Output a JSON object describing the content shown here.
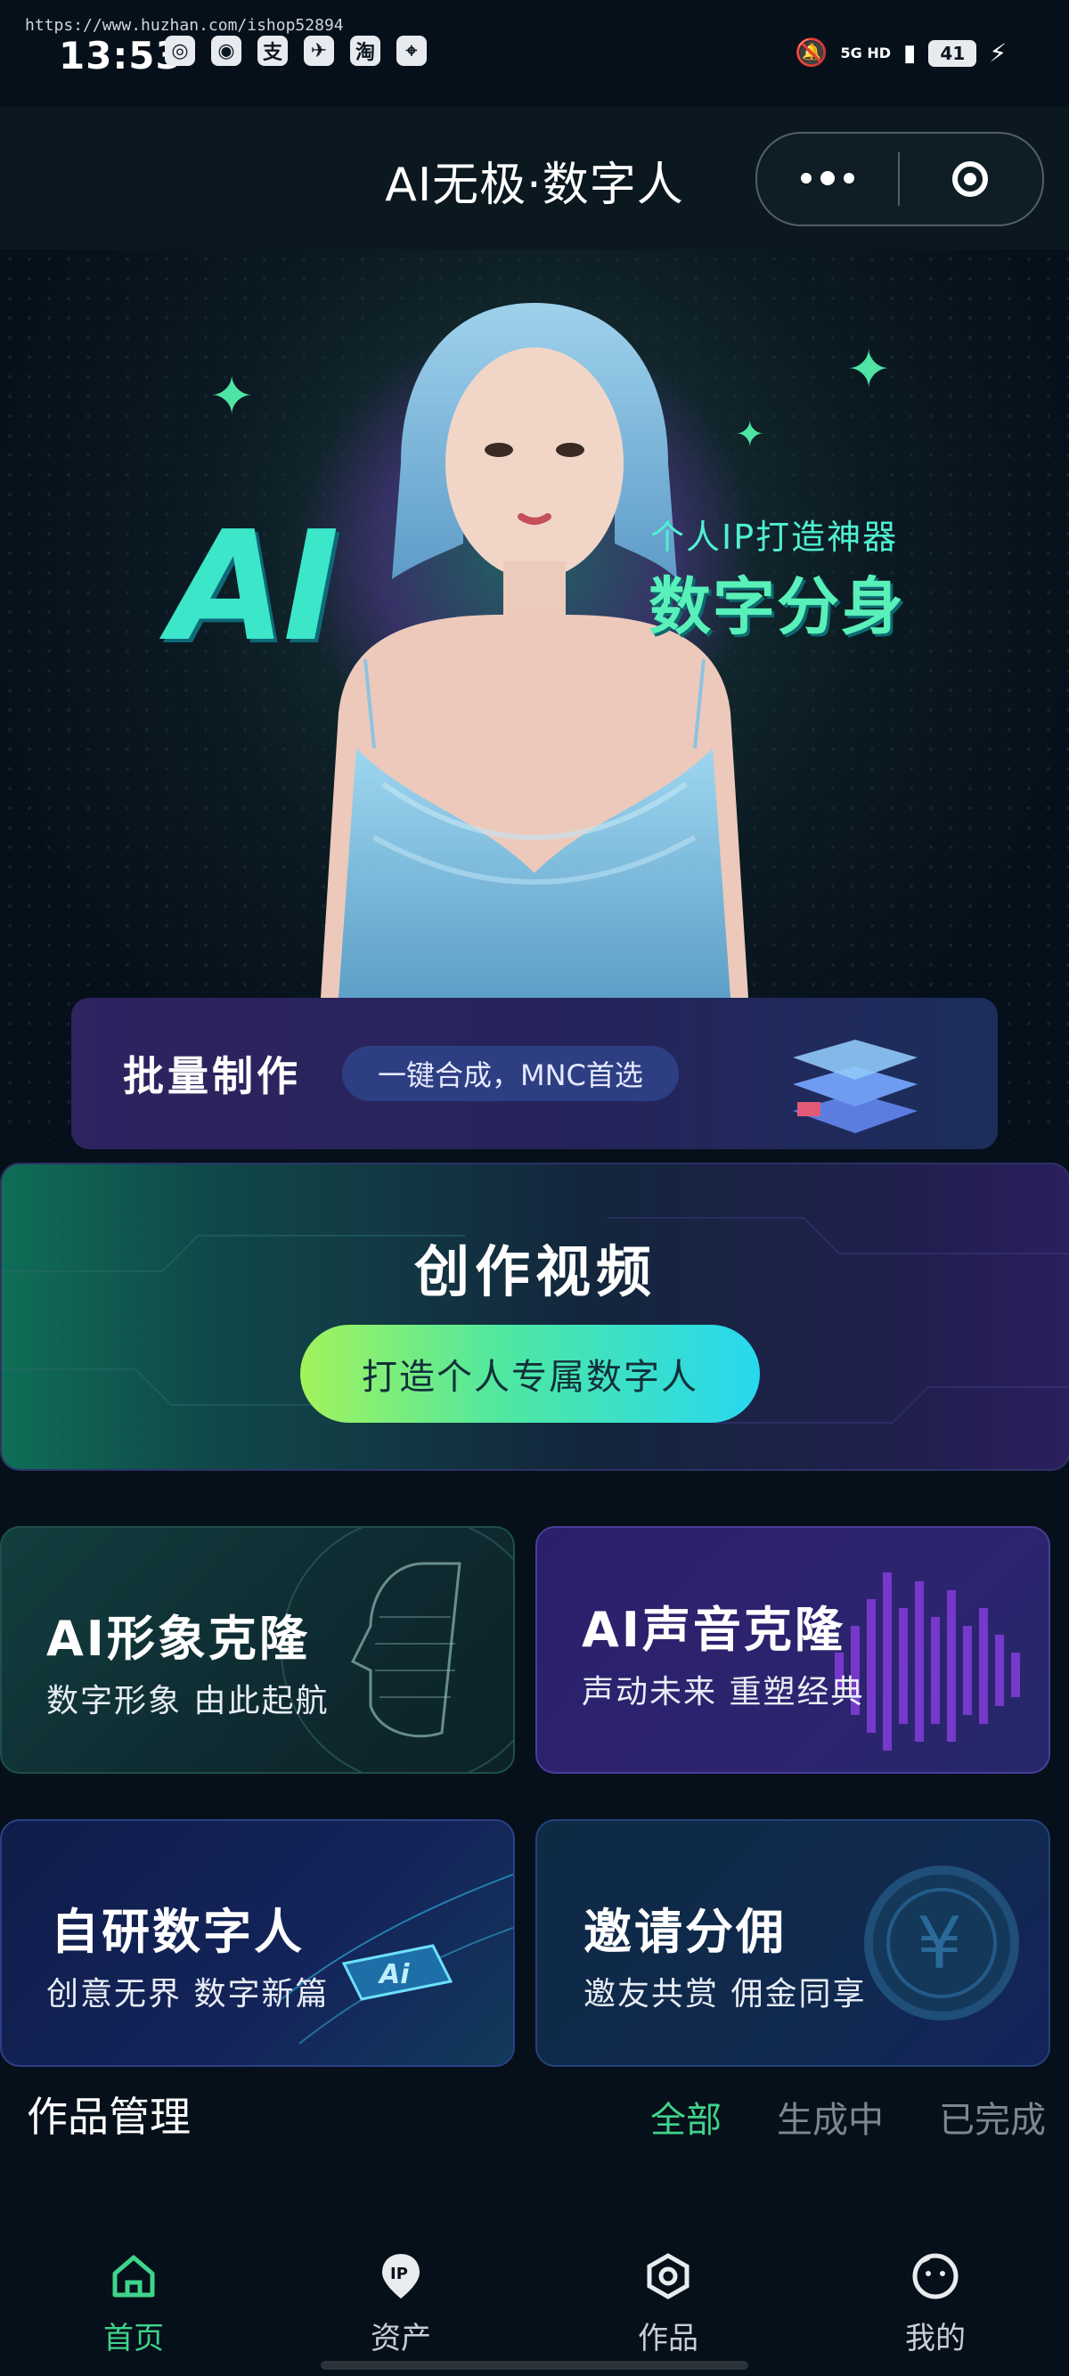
{
  "status_bar": {
    "watermark": "https://www.huzhan.com/ishop52894",
    "time": "13:53",
    "network": "5G HD",
    "battery": "41",
    "icons": [
      "circle-app-icon",
      "weibo-icon",
      "alipay-icon",
      "bird-icon",
      "taobao-icon",
      "location-icon"
    ]
  },
  "titlebar": {
    "title": "AI无极·数字人"
  },
  "banner": {
    "big_text": "AI",
    "subtitle": "个人IP打造神器",
    "headline": "数字分身"
  },
  "batch": {
    "title": "批量制作",
    "pill": "一键合成，MNC首选"
  },
  "create": {
    "title": "创作视频",
    "button": "打造个人专属数字人"
  },
  "cards": [
    {
      "title": "AI形象克隆",
      "sub": "数字形象 由此起航"
    },
    {
      "title": "AI声音克隆",
      "sub": "声动未来 重塑经典"
    },
    {
      "title": "自研数字人",
      "sub": "创意无界 数字新篇"
    },
    {
      "title": "邀请分佣",
      "sub": "邀友共赏 佣金同享"
    }
  ],
  "works": {
    "title": "作品管理",
    "tabs": [
      "全部",
      "生成中",
      "已完成"
    ]
  },
  "nav": [
    {
      "label": "首页",
      "icon": "home-icon"
    },
    {
      "label": "资产",
      "icon": "ip-pin-icon"
    },
    {
      "label": "作品",
      "icon": "works-icon"
    },
    {
      "label": "我的",
      "icon": "profile-icon"
    }
  ],
  "colors": {
    "accent_green": "#3fd48b",
    "background": "#06101a"
  }
}
